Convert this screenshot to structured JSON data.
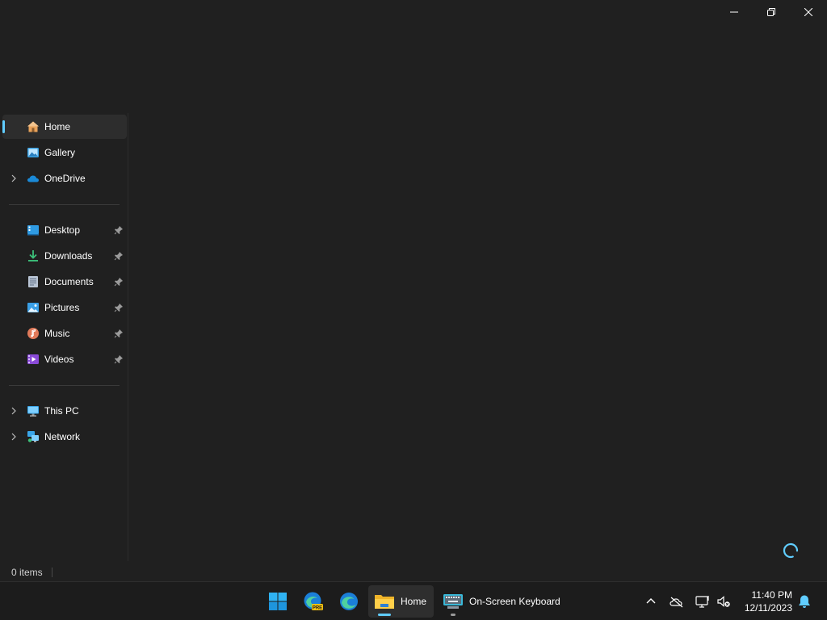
{
  "window": {
    "caption_buttons": [
      "minimize",
      "restore",
      "close"
    ]
  },
  "sidebar": {
    "quick": [
      {
        "label": "Home",
        "icon": "home-icon",
        "selected": true,
        "expandable": false
      },
      {
        "label": "Gallery",
        "icon": "gallery-icon",
        "selected": false,
        "expandable": false
      },
      {
        "label": "OneDrive",
        "icon": "onedrive-icon",
        "selected": false,
        "expandable": true
      }
    ],
    "pinned": [
      {
        "label": "Desktop",
        "icon": "desktop-folder-icon"
      },
      {
        "label": "Downloads",
        "icon": "downloads-folder-icon"
      },
      {
        "label": "Documents",
        "icon": "documents-folder-icon"
      },
      {
        "label": "Pictures",
        "icon": "pictures-folder-icon"
      },
      {
        "label": "Music",
        "icon": "music-folder-icon"
      },
      {
        "label": "Videos",
        "icon": "videos-folder-icon"
      }
    ],
    "devices": [
      {
        "label": "This PC",
        "icon": "this-pc-icon",
        "expandable": true
      },
      {
        "label": "Network",
        "icon": "network-icon",
        "expandable": true
      }
    ]
  },
  "status": {
    "item_count": "0 items"
  },
  "taskbar": {
    "apps": [
      {
        "name": "start",
        "icon": "windows-start-icon"
      },
      {
        "name": "edge-preview",
        "icon": "edge-preview-icon",
        "badge": "PRE"
      },
      {
        "name": "edge",
        "icon": "edge-icon"
      },
      {
        "name": "file-explorer",
        "icon": "file-explorer-icon",
        "label": "Home",
        "active": true
      },
      {
        "name": "on-screen-keyboard",
        "icon": "keyboard-icon",
        "label": "On-Screen Keyboard",
        "active": false
      }
    ],
    "tray": {
      "time": "11:40 PM",
      "date": "12/11/2023",
      "icons": [
        "chevron-up-icon",
        "onedrive-offline-icon",
        "network-status-icon",
        "volume-muted-icon",
        "notification-bell-icon"
      ]
    }
  },
  "colors": {
    "background": "#202020",
    "taskbar": "#1c1c1c",
    "accent": "#60cdff",
    "text": "#ffffff"
  }
}
